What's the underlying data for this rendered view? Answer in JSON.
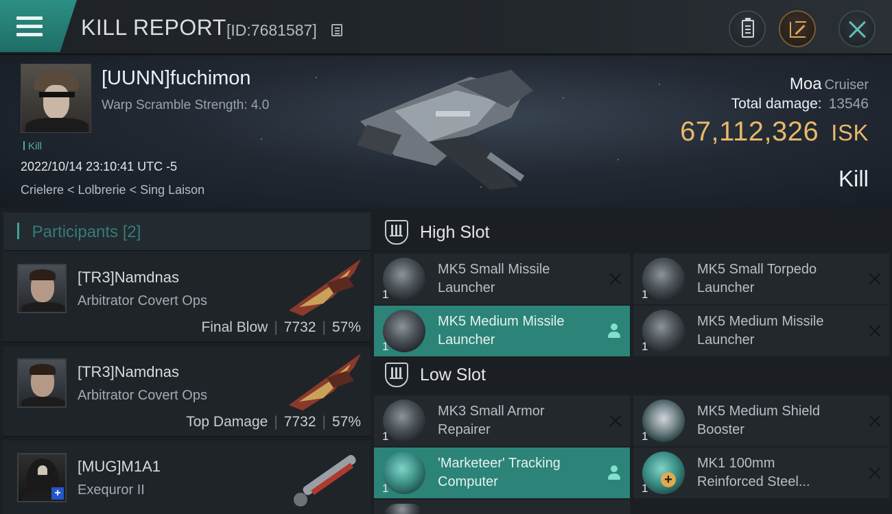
{
  "header": {
    "title": "KILL REPORT",
    "report_id": "[ID:7681587]"
  },
  "victim": {
    "name": "[UUNN]fuchimon",
    "warp_scramble": "Warp Scramble Strength: 4.0",
    "tag": "Kill",
    "datetime": "2022/10/14 23:10:41 UTC -5",
    "location": "Crielere < Lolbrerie < Sing Laison",
    "ship_name": "Moa",
    "ship_class": "Cruiser",
    "total_damage_label": "Total damage:",
    "total_damage": "13546",
    "isk_value": "67,112,326",
    "isk_unit": "ISK",
    "result": "Kill"
  },
  "participants": {
    "label": "Participants",
    "count": "[2]",
    "rows": [
      {
        "name": "[TR3]Namdnas",
        "ship": "Arbitrator Covert Ops",
        "role": "Final Blow",
        "damage": "7732",
        "percent": "57%"
      },
      {
        "name": "[TR3]Namdnas",
        "ship": "Arbitrator Covert Ops",
        "role": "Top Damage",
        "damage": "7732",
        "percent": "57%"
      },
      {
        "name": "[MUG]M1A1",
        "ship": "Exequror II"
      }
    ]
  },
  "slots": {
    "high": {
      "title": "High Slot",
      "modules": [
        {
          "qty": "1",
          "name_line1": "MK5 Small Missile",
          "name_line2": "Launcher"
        },
        {
          "qty": "1",
          "name_line1": "MK5 Small Torpedo",
          "name_line2": "Launcher"
        },
        {
          "qty": "1",
          "name_line1": "MK5 Medium Missile",
          "name_line2": "Launcher"
        },
        {
          "qty": "1",
          "name_line1": "MK5 Medium Missile",
          "name_line2": "Launcher"
        }
      ]
    },
    "low": {
      "title": "Low Slot",
      "modules": [
        {
          "qty": "1",
          "name_line1": "MK3 Small Armor",
          "name_line2": "Repairer"
        },
        {
          "qty": "1",
          "name_line1": "MK5 Medium Shield",
          "name_line2": "Booster"
        },
        {
          "qty": "1",
          "name_line1": "'Marketeer' Tracking",
          "name_line2": "Computer"
        },
        {
          "qty": "1",
          "name_line1": "MK1 100mm",
          "name_line2": "Reinforced Steel..."
        }
      ]
    }
  },
  "colors": {
    "accent_teal": "#2c8478",
    "isk_gold": "#e8b86a",
    "background": "#1b1f24"
  }
}
